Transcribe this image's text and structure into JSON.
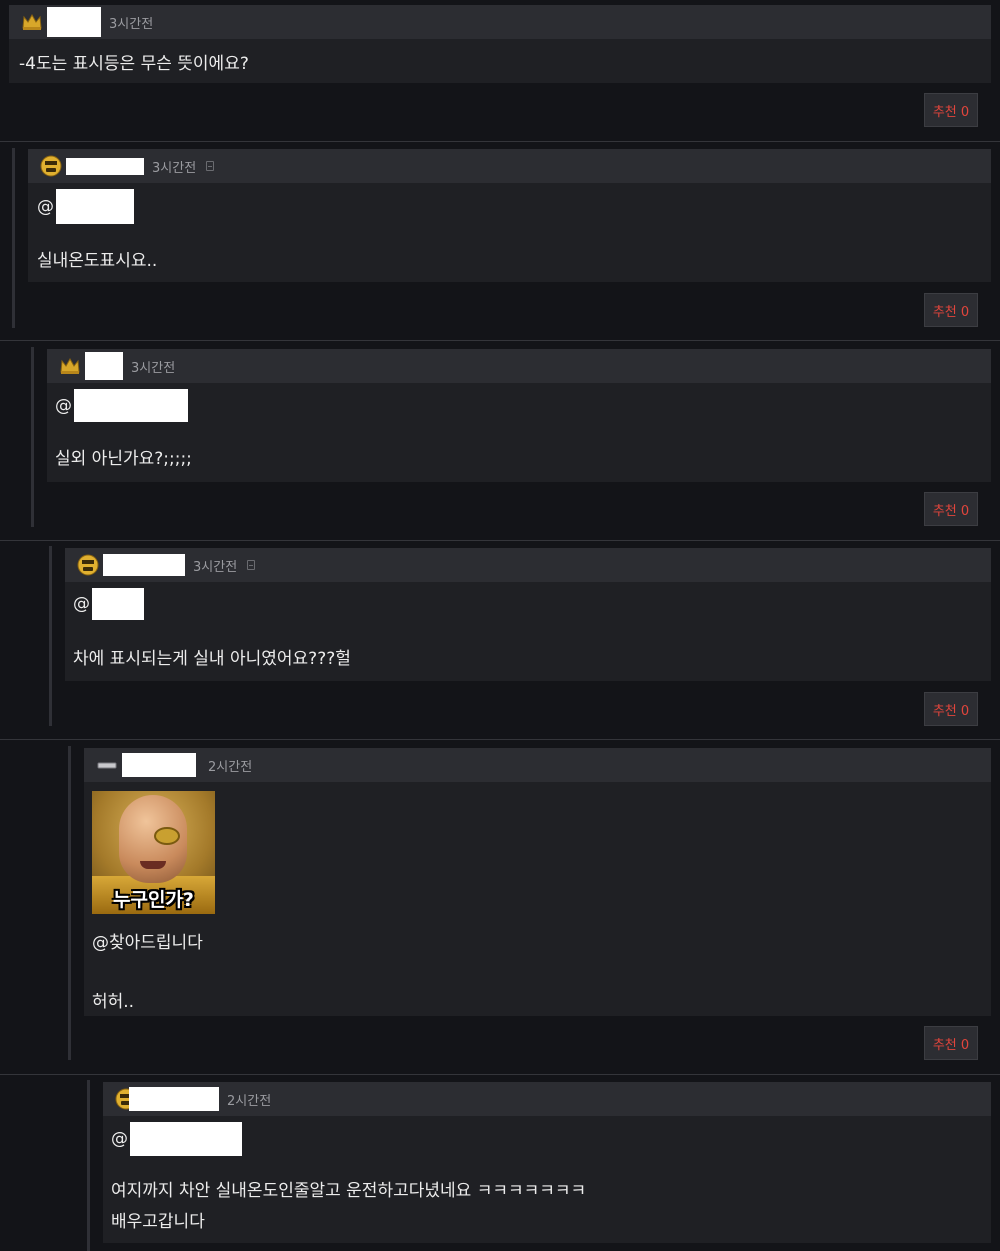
{
  "recommend_label": "추천 0",
  "comments": [
    {
      "time": "3시간전",
      "badge": "crown-gold",
      "text": "-4도는 표시등은 무슨 뜻이에요?"
    },
    {
      "time": "3시간전",
      "badge": "smiley-gold",
      "mention": "@",
      "text": "실내온도표시요.."
    },
    {
      "time": "3시간전",
      "badge": "crown-gold",
      "mention": "@",
      "text": "실외 아닌가요?;;;;;"
    },
    {
      "time": "3시간전",
      "badge": "smiley-gold",
      "mention": "@",
      "text": "차에 표시되는게 실내 아니였어요???헐"
    },
    {
      "time": "2시간전",
      "badge": "bar-gray",
      "image_caption": "누구인가?",
      "lines": [
        "@찾아드립니다",
        "허허.."
      ]
    },
    {
      "time": "2시간전",
      "badge": "smiley-gold",
      "mention": "@",
      "lines": [
        "여지까지 차안 실내온도인줄알고 운전하고다녔네요 ㅋㅋㅋㅋㅋㅋㅋ",
        "배우고갑니다"
      ]
    }
  ]
}
